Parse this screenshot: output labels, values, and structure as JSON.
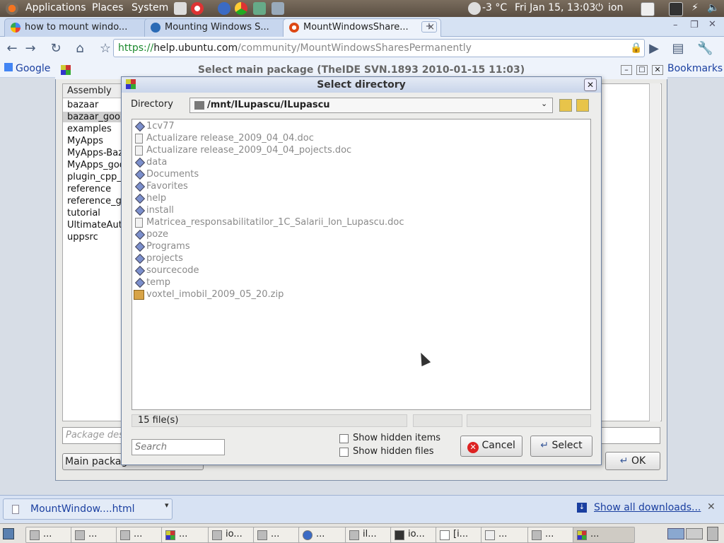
{
  "top_panel": {
    "menus": [
      "Applications",
      "Places",
      "System"
    ],
    "weather": "-3 °C",
    "datetime": "Fri Jan 15, 13:03",
    "user": "ion"
  },
  "tabs": [
    {
      "label": "how to mount windo...",
      "active": false
    },
    {
      "label": "Mounting Windows S...",
      "active": false
    },
    {
      "label": "MountWindowsShare...",
      "active": true
    }
  ],
  "url": {
    "scheme": "https://",
    "host": "help.ubuntu.com",
    "path": "/community/MountWindowsSharesPermanently"
  },
  "bookmarks": {
    "google": "Google",
    "other": "Bookmarks"
  },
  "main_window": {
    "title": "Select main package (TheIDE SVN.1893 2010-01-15 11:03)",
    "assembly_header": "Assembly",
    "assemblies": [
      "bazaar",
      "bazaar_goo",
      "examples",
      "MyApps",
      "MyApps-Baz",
      "MyApps_goo",
      "plugin_cpp_",
      "reference",
      "reference_g",
      "tutorial",
      "UltimateAut",
      "uppsrc"
    ],
    "selected_assembly": "bazaar_goo",
    "package_desc_placeholder": "Package des",
    "main_package_label": "Main packag",
    "ok_label": "OK"
  },
  "dialog": {
    "title": "Select directory",
    "directory_label": "Directory",
    "directory_value": "/mnt/ILupascu/ILupascu",
    "files": [
      {
        "name": "1cv77",
        "type": "folder"
      },
      {
        "name": "Actualizare release_2009_04_04.doc",
        "type": "doc"
      },
      {
        "name": "Actualizare release_2009_04_04_pojects.doc",
        "type": "doc"
      },
      {
        "name": "data",
        "type": "folder"
      },
      {
        "name": "Documents",
        "type": "folder"
      },
      {
        "name": "Favorites",
        "type": "folder"
      },
      {
        "name": "help",
        "type": "folder"
      },
      {
        "name": "install",
        "type": "folder"
      },
      {
        "name": "Matricea_responsabilitatilor_1C_Salarii_Ion_Lupascu.doc",
        "type": "doc"
      },
      {
        "name": "poze",
        "type": "folder"
      },
      {
        "name": "Programs",
        "type": "folder"
      },
      {
        "name": "projects",
        "type": "folder"
      },
      {
        "name": "sourcecode",
        "type": "folder"
      },
      {
        "name": "temp",
        "type": "folder"
      },
      {
        "name": "voxtel_imobil_2009_05_20.zip",
        "type": "zip"
      }
    ],
    "status_count": "15 file(s)",
    "search_placeholder": "Search",
    "show_hidden_items": "Show hidden items",
    "show_hidden_files": "Show hidden files",
    "cancel_label": "Cancel",
    "select_label": "Select"
  },
  "downloads": {
    "file": "MountWindow....html",
    "show_all": "Show all downloads..."
  },
  "taskbar": [
    "...",
    "...",
    "...",
    "...",
    "io...",
    "...",
    "...",
    "il...",
    "io...",
    "[i...",
    "...",
    "...",
    "..."
  ],
  "colors": {
    "panel": "#5a4e42",
    "accent": "#1d8a2e",
    "link": "#1a3fa0",
    "cancel_red": "#d22"
  }
}
